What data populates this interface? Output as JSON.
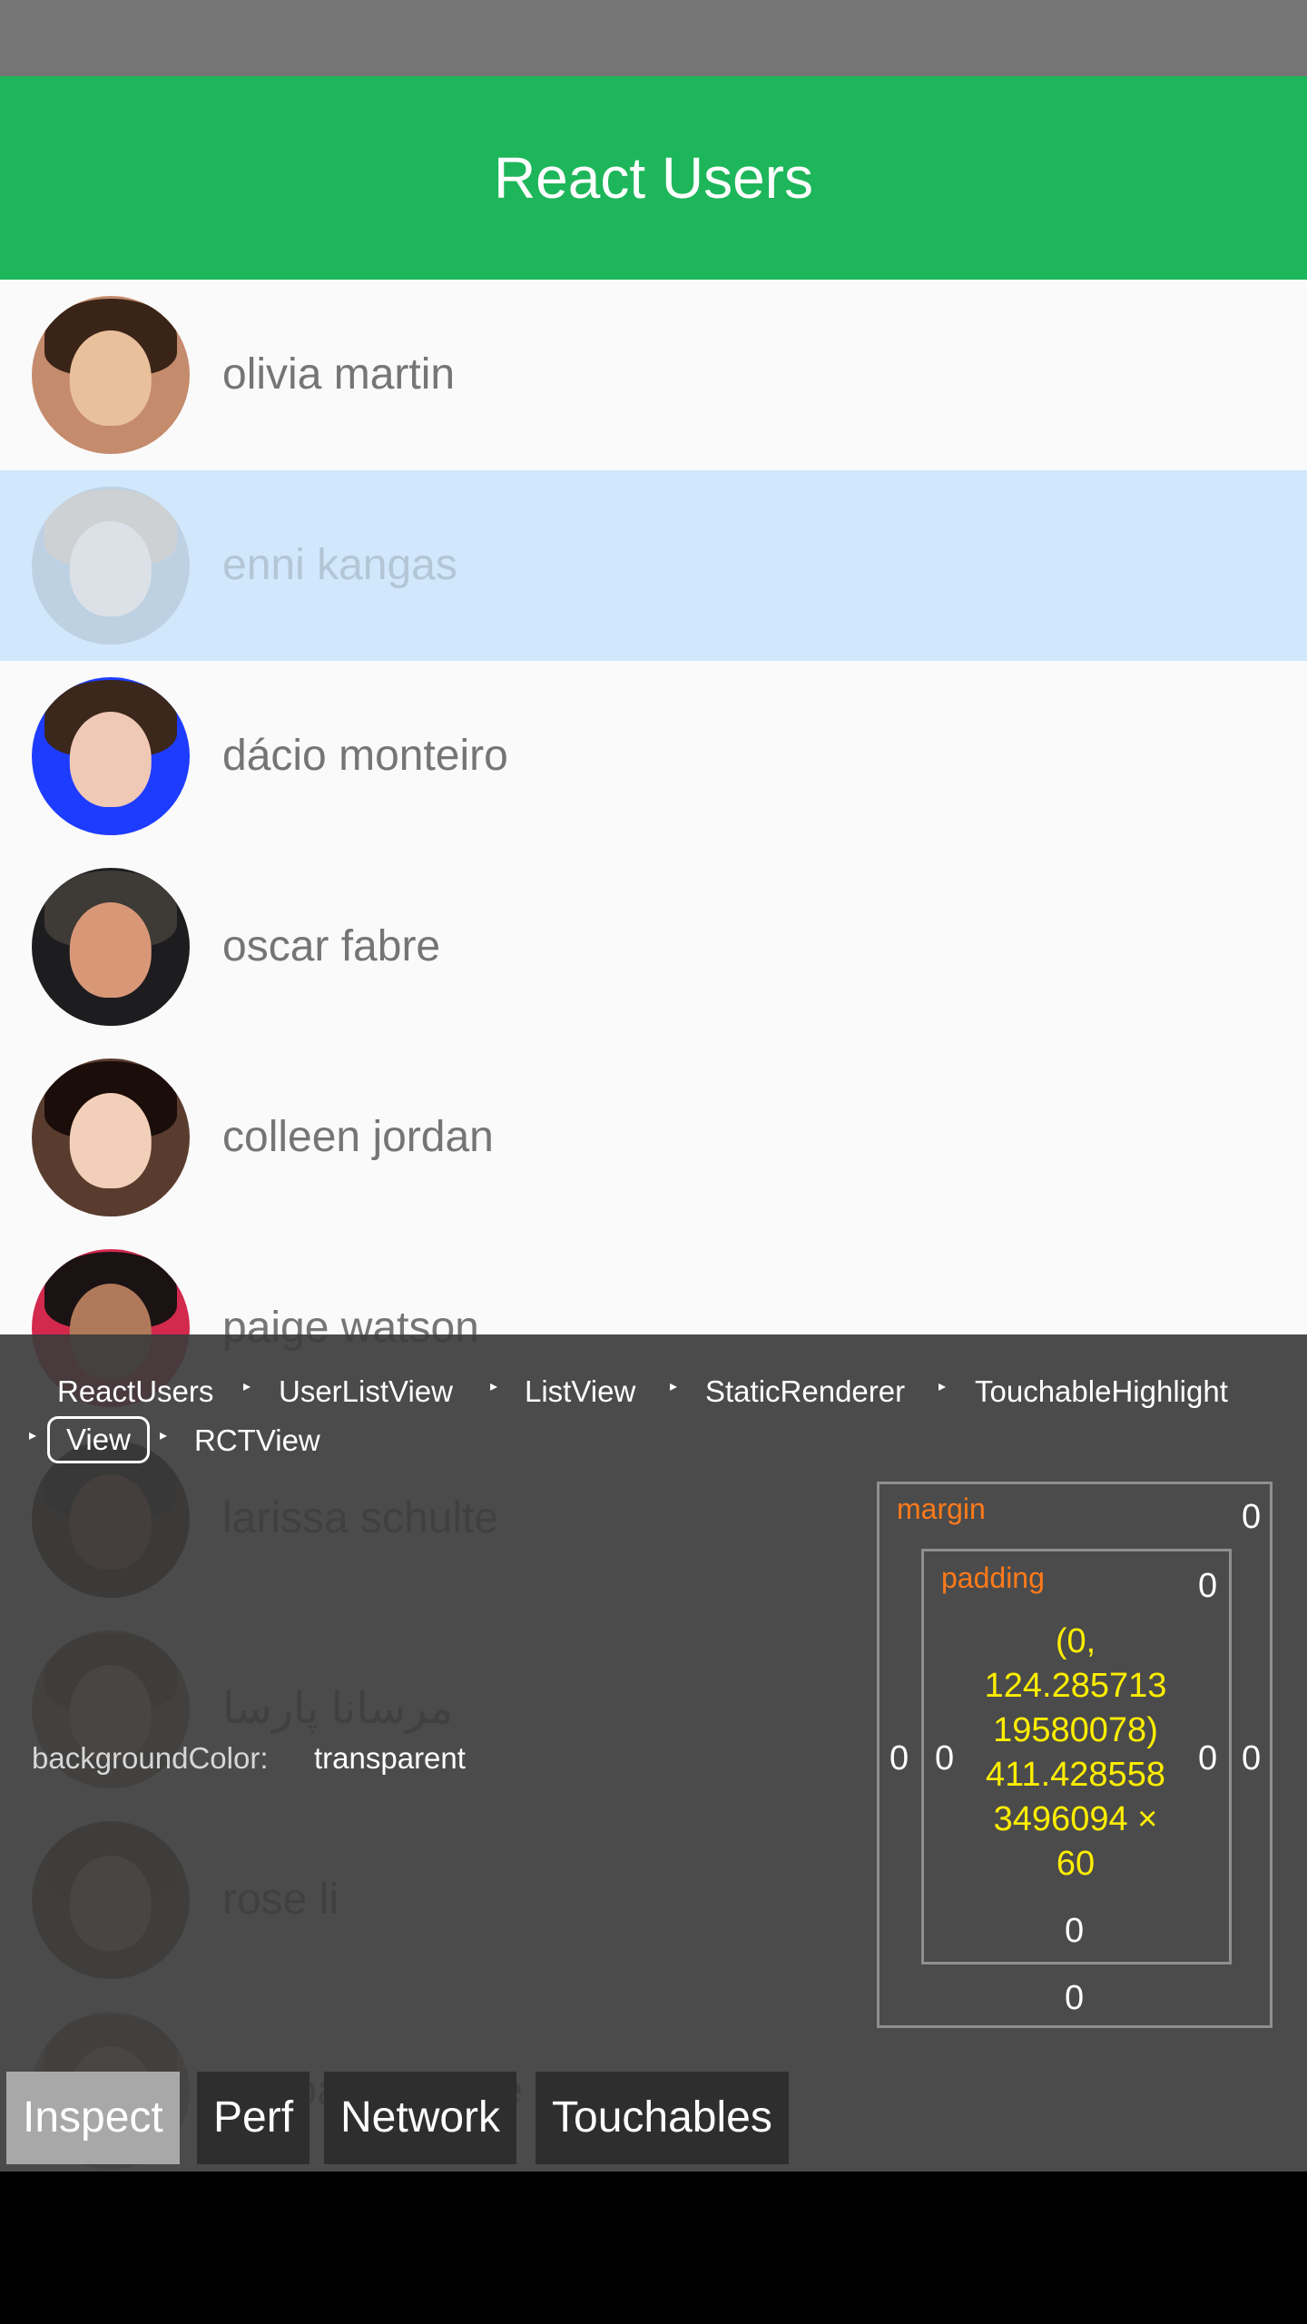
{
  "app": {
    "title": "React Users"
  },
  "users": [
    {
      "name": "olivia martin",
      "skin": "#e9c09c",
      "hair": "#3a2417",
      "body": "#c48b6c"
    },
    {
      "name": "enni kangas",
      "skin": "#eed7c4",
      "hair": "#c9a98b",
      "body": "#9aa9b6",
      "selected": true
    },
    {
      "name": "dácio monteiro",
      "skin": "#f0c8b6",
      "hair": "#3b271b",
      "body": "#1e3cff"
    },
    {
      "name": "oscar fabre",
      "skin": "#d89878",
      "hair": "#3e3a35",
      "body": "#1d1d1f"
    },
    {
      "name": "colleen jordan",
      "skin": "#f2cfb8",
      "hair": "#1a0d0a",
      "body": "#5a3c2f"
    },
    {
      "name": "paige watson",
      "skin": "#b07a5a",
      "hair": "#1b1213",
      "body": "#d2294d"
    },
    {
      "name": "larissa schulte",
      "skin": "#a26a4e",
      "hair": "#1f1510",
      "body": "#3a2a22"
    },
    {
      "name": "مرسانا پارسا",
      "skin": "#d8b49a",
      "hair": "#6a4a33",
      "body": "#8c7a6a"
    },
    {
      "name": "rose li",
      "skin": "#d8b49a",
      "hair": "#6a4b34",
      "body": "#6b6054"
    },
    {
      "name": "gaspard lefevre",
      "skin": "#dcc0ad",
      "hair": "#8e7766",
      "body": "#b0a49a"
    }
  ],
  "inspector": {
    "breadcrumbs": [
      "ReactUsers",
      "UserListView",
      "ListView",
      "StaticRenderer",
      "TouchableHighlight",
      "View",
      "RCTView"
    ],
    "active_crumb": "View",
    "style": {
      "key": "backgroundColor:",
      "value": "transparent"
    },
    "margin": {
      "label": "margin",
      "top": "0",
      "left": "0",
      "right": "0",
      "bottom": "0"
    },
    "padding": {
      "label": "padding",
      "top": "0",
      "left": "0",
      "right": "0",
      "bottom": "0"
    },
    "dimensions_lines": [
      "(0,",
      "124.285713",
      "19580078)",
      "411.428558",
      "3496094 ×",
      "60"
    ],
    "tabs": [
      "Inspect",
      "Perf",
      "Network",
      "Touchables"
    ],
    "active_tab": "Inspect"
  }
}
